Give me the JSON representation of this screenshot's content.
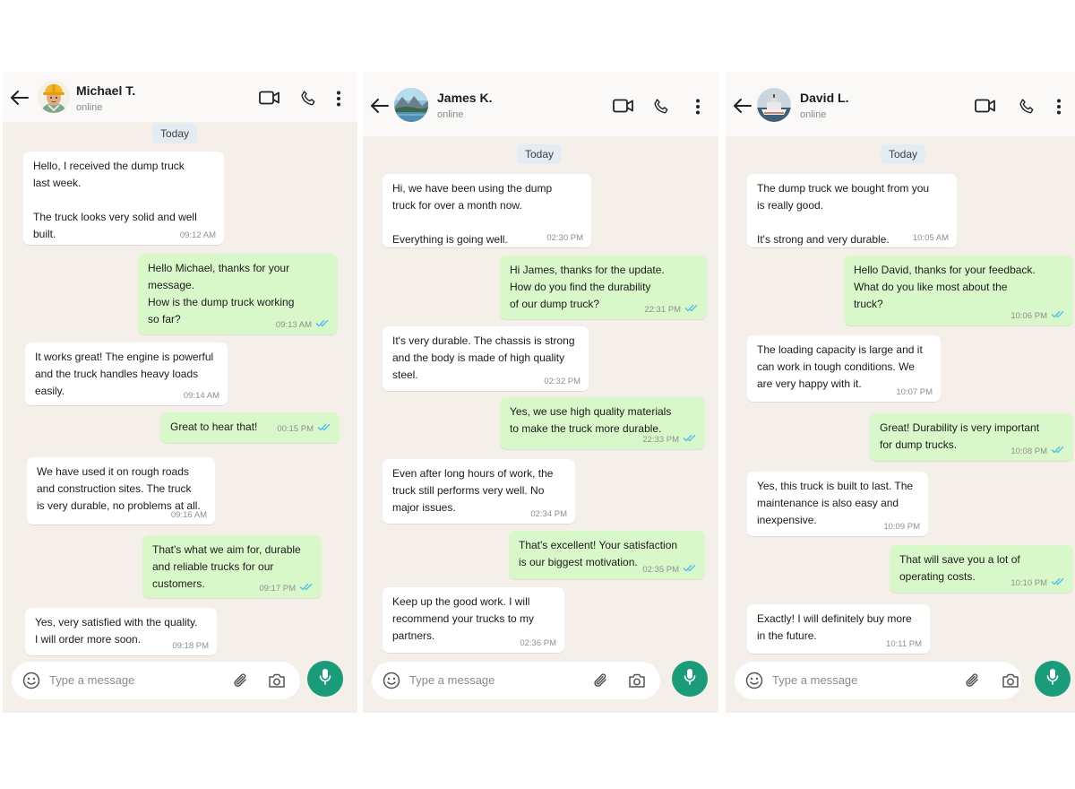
{
  "colors": {
    "sent_bubble": "#d9f8c9",
    "received_bubble": "#ffffff",
    "chat_background": "#f4efe8",
    "read_ticks": "#53bdeb",
    "mic_button": "#1a9b79"
  },
  "chats": [
    {
      "contact": {
        "name": "Michael T.",
        "status": "online",
        "avatar": "construction-worker-emoji"
      },
      "date_label": "Today",
      "composer": {
        "placeholder": "Type a message"
      },
      "messages": [
        {
          "dir": "in",
          "text": "Hello, I received the dump truck\nlast week.\n\nThe truck looks very solid and well\nbuilt.",
          "time": "09:12 AM"
        },
        {
          "dir": "out",
          "text": "Hello Michael, thanks for your\nmessage.\nHow is the dump truck working\nso far?",
          "time": "09:13 AM",
          "read": true
        },
        {
          "dir": "in",
          "text": "It works great! The engine is powerful\nand the truck handles heavy loads\neasily.",
          "time": "09:14 AM"
        },
        {
          "dir": "out",
          "text": "Great to hear that!",
          "time": "00:15 PM",
          "read": true
        },
        {
          "dir": "in",
          "text": "We have used it on rough roads\nand construction sites. The truck\nis very durable, no problems at all.",
          "time": "09:16 AM"
        },
        {
          "dir": "out",
          "text": "That's what we aim for, durable\nand reliable trucks for our\ncustomers.",
          "time": "09:17 PM",
          "read": true
        },
        {
          "dir": "in",
          "text": "Yes, very satisfied with the quality.\nI will order more soon.",
          "time": "09:18 PM"
        }
      ]
    },
    {
      "contact": {
        "name": "James K.",
        "status": "online",
        "avatar": "landscape-photo"
      },
      "date_label": "Today",
      "composer": {
        "placeholder": "Type a message"
      },
      "messages": [
        {
          "dir": "in",
          "text": "Hi, we have been using the dump\ntruck for over a month now.\n\nEverything is going well.",
          "time": "02:30 PM"
        },
        {
          "dir": "out",
          "text": "Hi James, thanks for the update.\nHow do you find the durability\nof our dump truck?",
          "time": "22:31 PM",
          "read": true
        },
        {
          "dir": "in",
          "text": "It's very durable. The chassis is strong\nand the body is made of high quality\nsteel.",
          "time": "02:32 PM"
        },
        {
          "dir": "out",
          "text": "Yes, we use high quality materials\nto make the truck more durable.",
          "time": "22:33 PM",
          "read": true
        },
        {
          "dir": "in",
          "text": "Even after long hours of work, the\ntruck still performs very well. No\nmajor issues.",
          "time": "02:34 PM"
        },
        {
          "dir": "out",
          "text": "That's excellent! Your satisfaction\nis our biggest motivation.",
          "time": "02:35 PM",
          "read": true
        },
        {
          "dir": "in",
          "text": "Keep up the good work. I will\nrecommend your trucks to my\npartners.",
          "time": "02:36 PM"
        }
      ]
    },
    {
      "contact": {
        "name": "David L.",
        "status": "online",
        "avatar": "ship-photo"
      },
      "date_label": "Today",
      "composer": {
        "placeholder": "Type a message"
      },
      "messages": [
        {
          "dir": "in",
          "text": "The dump truck we bought from you\nis really good.\n\nIt's strong and very durable.",
          "time": "10:05 AM"
        },
        {
          "dir": "out",
          "text": "Hello David, thanks for your feedback.\nWhat do you like most about the\ntruck?",
          "time": "10:06 PM",
          "read": true
        },
        {
          "dir": "in",
          "text": "The loading capacity is large and it\ncan work in tough conditions. We\nare very happy with it.",
          "time": "10:07 PM"
        },
        {
          "dir": "out",
          "text": "Great! Durability is very important\nfor dump trucks.",
          "time": "10:08 PM",
          "read": true
        },
        {
          "dir": "in",
          "text": "Yes, this truck is built to last. The\nmaintenance is also easy and\ninexpensive.",
          "time": "10:09 PM"
        },
        {
          "dir": "out",
          "text": "That will save you a lot of\noperating costs.",
          "time": "10:10 PM",
          "read": true
        },
        {
          "dir": "in",
          "text": "Exactly! I will definitely buy more\nin the future.",
          "time": "10:11 PM"
        }
      ]
    }
  ]
}
